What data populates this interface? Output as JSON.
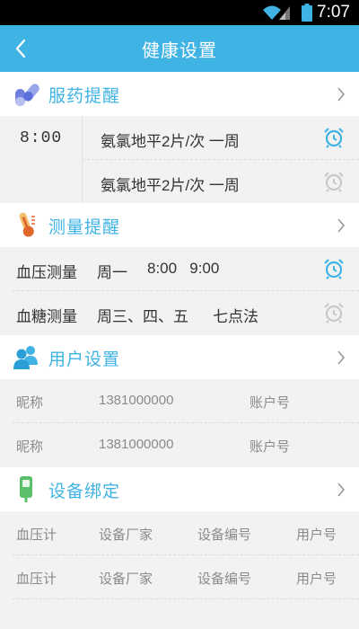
{
  "status_bar": {
    "time": "7:07",
    "icons": [
      "wifi-icon",
      "signal-icon",
      "battery-icon"
    ]
  },
  "app_bar": {
    "title": "健康设置",
    "back_icon": "chevron-left-icon"
  },
  "colors": {
    "accent": "#3fb3e4",
    "alarm_on": "#3fb3e4",
    "alarm_off": "#c8c8c8",
    "background": "#f2f2f2"
  },
  "medication": {
    "title": "服药提醒",
    "icon": "pills-icon",
    "time": "8:00",
    "items": [
      {
        "text": "氨氯地平2片/次  一周",
        "alarm_on": true
      },
      {
        "text": "氨氯地平2片/次  一周",
        "alarm_on": false
      }
    ]
  },
  "measurement": {
    "title": "测量提醒",
    "icon": "thermometer-icon",
    "items": [
      {
        "name": "血压测量",
        "days": "周一",
        "times": "8:00   9:00",
        "alarm_on": true
      },
      {
        "name": "血糖测量",
        "days": "周三、四、五",
        "times": "七点法",
        "alarm_on": false
      }
    ]
  },
  "users": {
    "title": "用户设置",
    "icon": "users-icon",
    "items": [
      {
        "nickname": "昵称",
        "phone": "1381000000",
        "account": "账户号"
      },
      {
        "nickname": "昵称",
        "phone": "1381000000",
        "account": "账户号"
      }
    ]
  },
  "devices": {
    "title": "设备绑定",
    "icon": "glucometer-icon",
    "items": [
      {
        "type": "血压计",
        "maker": "设备厂家",
        "serial": "设备编号",
        "user": "用户号"
      },
      {
        "type": "血压计",
        "maker": "设备厂家",
        "serial": "设备编号",
        "user": "用户号"
      }
    ]
  }
}
